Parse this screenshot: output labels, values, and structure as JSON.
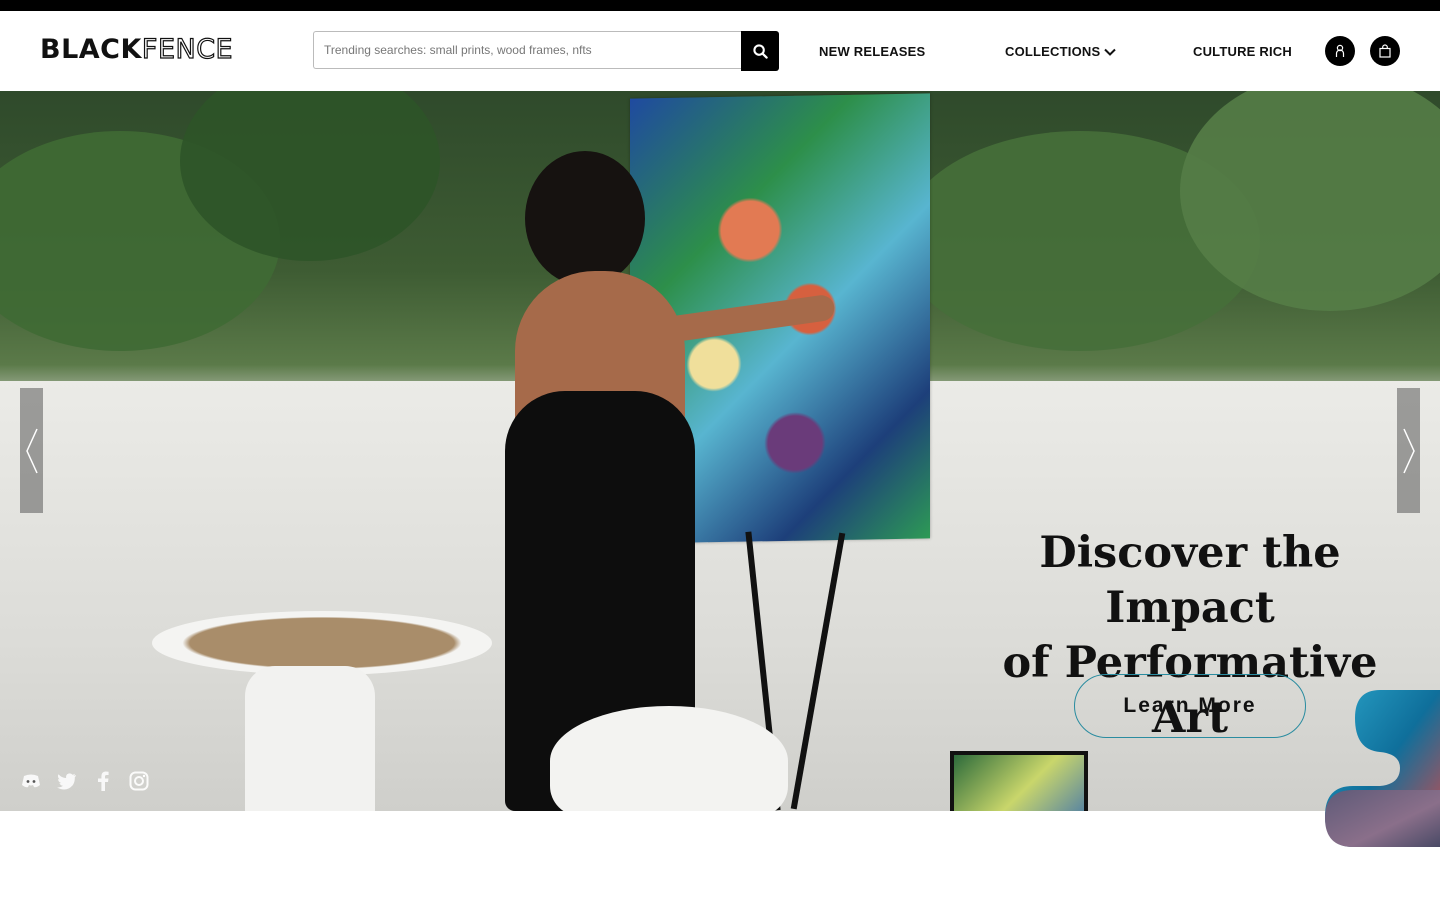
{
  "brand": {
    "logo_bold": "BLACK",
    "logo_outline": "FENCE"
  },
  "search": {
    "placeholder": "Trending searches: small prints, wood frames, nfts",
    "icon": "search-icon"
  },
  "nav": {
    "items": [
      {
        "label": "NEW RELEASES"
      },
      {
        "label": "COLLECTIONS",
        "icon": "chevron-down-icon"
      },
      {
        "label": "CULTURE RICH"
      }
    ]
  },
  "header_actions": {
    "account_icon": "user-icon",
    "cart_icon": "shopping-bag-icon"
  },
  "hero": {
    "headline_line1": "Discover the Impact",
    "headline_line2": "of Performative Art",
    "cta_label": "Learn More",
    "prev_icon": "chevron-left-icon",
    "next_icon": "chevron-right-icon"
  },
  "socials": [
    "discord-icon",
    "twitter-icon",
    "facebook-icon",
    "instagram-icon"
  ],
  "colors": {
    "topbar": "#000000",
    "accent_border": "#2a8ca0",
    "text": "#111111"
  }
}
